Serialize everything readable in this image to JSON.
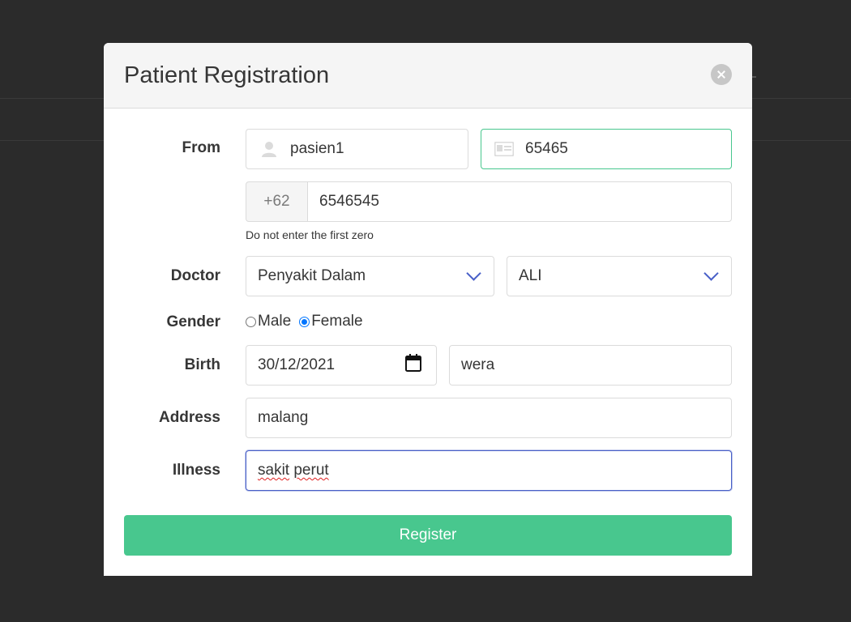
{
  "modal": {
    "title": "Patient Registration",
    "close_icon": "close-icon"
  },
  "form": {
    "from": {
      "label": "From",
      "username_value": "pasien1",
      "username_icon": "user-icon",
      "id_value": "65465",
      "id_icon": "id-card-icon",
      "phone_prefix": "+62",
      "phone_value": "6546545",
      "phone_help": "Do not enter the first zero"
    },
    "doctor": {
      "label": "Doctor",
      "specialty_value": "Penyakit Dalam",
      "doctor_value": "ALI"
    },
    "gender": {
      "label": "Gender",
      "options": [
        "Male",
        "Female"
      ],
      "selected": "Female"
    },
    "birth": {
      "label": "Birth",
      "date_value": "30/12/2021",
      "place_value": "wera"
    },
    "address": {
      "label": "Address",
      "value": "malang"
    },
    "illness": {
      "label": "Illness",
      "value_word1": "sakit",
      "value_word2": "perut"
    },
    "submit_label": "Register"
  },
  "colors": {
    "accent_green": "#48c78e",
    "focus_blue": "#485fc7",
    "radio_blue": "#0075ff"
  }
}
